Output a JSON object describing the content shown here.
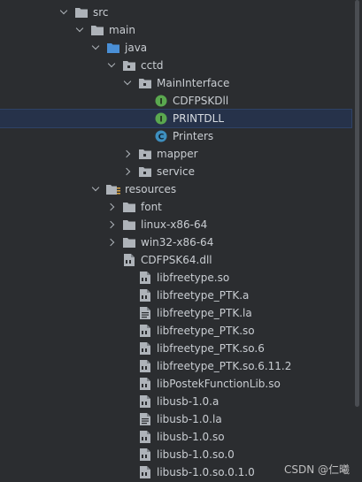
{
  "tree": {
    "items": [
      {
        "label": "src",
        "icon": "folder-icon",
        "expand": "down"
      },
      {
        "label": "main",
        "icon": "folder-icon",
        "expand": "down"
      },
      {
        "label": "java",
        "icon": "source-folder-icon",
        "expand": "down"
      },
      {
        "label": "cctd",
        "icon": "package-icon",
        "expand": "down"
      },
      {
        "label": "MainInterface",
        "icon": "package-icon",
        "expand": "down"
      },
      {
        "label": "CDFPSKDll",
        "icon": "interface-icon",
        "expand": "none"
      },
      {
        "label": "PRINTDLL",
        "icon": "interface-icon",
        "expand": "none",
        "selected": true
      },
      {
        "label": "Printers",
        "icon": "class-icon",
        "expand": "none"
      },
      {
        "label": "mapper",
        "icon": "package-icon",
        "expand": "right"
      },
      {
        "label": "service",
        "icon": "package-icon",
        "expand": "right"
      },
      {
        "label": "resources",
        "icon": "resources-folder-icon",
        "expand": "down"
      },
      {
        "label": "font",
        "icon": "folder-icon",
        "expand": "right"
      },
      {
        "label": "linux-x86-64",
        "icon": "folder-icon",
        "expand": "right"
      },
      {
        "label": "win32-x86-64",
        "icon": "folder-icon",
        "expand": "right"
      },
      {
        "label": "CDFPSK64.dll",
        "icon": "binary-file-icon",
        "expand": "none"
      },
      {
        "label": "libfreetype.so",
        "icon": "binary-file-icon",
        "expand": "none"
      },
      {
        "label": "libfreetype_PTK.a",
        "icon": "binary-file-icon",
        "expand": "none"
      },
      {
        "label": "libfreetype_PTK.la",
        "icon": "text-file-icon",
        "expand": "none"
      },
      {
        "label": "libfreetype_PTK.so",
        "icon": "binary-file-icon",
        "expand": "none"
      },
      {
        "label": "libfreetype_PTK.so.6",
        "icon": "binary-file-icon",
        "expand": "none"
      },
      {
        "label": "libfreetype_PTK.so.6.11.2",
        "icon": "binary-file-icon",
        "expand": "none"
      },
      {
        "label": "libPostekFunctionLib.so",
        "icon": "binary-file-icon",
        "expand": "none"
      },
      {
        "label": "libusb-1.0.a",
        "icon": "binary-file-icon",
        "expand": "none"
      },
      {
        "label": "libusb-1.0.la",
        "icon": "text-file-icon",
        "expand": "none"
      },
      {
        "label": "libusb-1.0.so",
        "icon": "binary-file-icon",
        "expand": "none"
      },
      {
        "label": "libusb-1.0.so.0",
        "icon": "binary-file-icon",
        "expand": "none"
      },
      {
        "label": "libusb-1.0.so.0.1.0",
        "icon": "binary-file-icon",
        "expand": "none"
      }
    ]
  },
  "watermark": "CSDN @仁曦",
  "colors": {
    "background": "#2b2d30",
    "selection": "#26324a",
    "folder": "#aeb3b9",
    "source_folder": "#4a8fd6",
    "interface_badge": "#5aa84f",
    "class_badge": "#3e8fbf"
  }
}
